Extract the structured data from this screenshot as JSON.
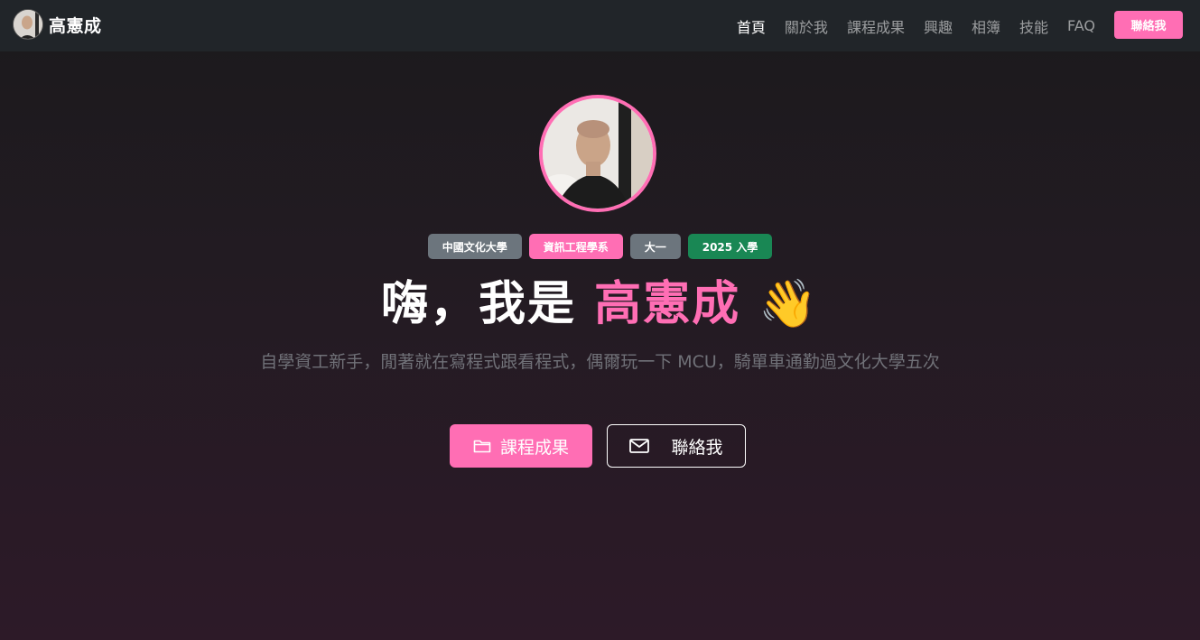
{
  "brand": {
    "name": "高憲成"
  },
  "nav": {
    "items": [
      {
        "label": "首頁"
      },
      {
        "label": "關於我"
      },
      {
        "label": "課程成果"
      },
      {
        "label": "興趣"
      },
      {
        "label": "相簿"
      },
      {
        "label": "技能"
      },
      {
        "label": "FAQ"
      }
    ],
    "contact_label": "聯絡我"
  },
  "hero": {
    "badges": [
      {
        "label": "中國文化大學",
        "color": "#6c757d"
      },
      {
        "label": "資訊工程學系",
        "color": "#ff6eb4"
      },
      {
        "label": "大一",
        "color": "#6c757d"
      },
      {
        "label": "2025 入學",
        "color": "#198754"
      }
    ],
    "headline_prefix": "嗨，我是 ",
    "headline_name": "高憲成",
    "headline_emoji": "👋",
    "subtitle": "自學資工新手，閒著就在寫程式跟看程式，偶爾玩一下 MCU，騎單車通勤過文化大學五次",
    "primary_button": "課程成果",
    "secondary_button": "聯絡我"
  },
  "colors": {
    "accent": "#ff6eb4",
    "navbar": "#212529"
  }
}
